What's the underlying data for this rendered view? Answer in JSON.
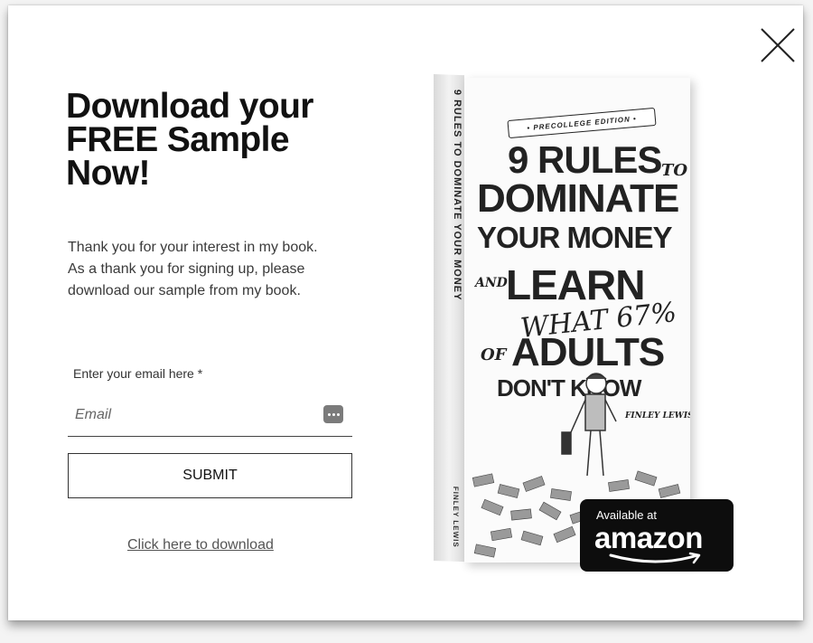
{
  "modal": {
    "close_icon": "close-icon",
    "headline": [
      "Download your",
      "FREE Sample",
      "Now!"
    ],
    "intro": [
      "Thank you for your interest in my book.",
      "As a thank you for signing up, please",
      "download our sample from my book."
    ],
    "email": {
      "label": "Enter your email here *",
      "placeholder": "Email",
      "value": "",
      "autofill_icon": "more-dots-icon"
    },
    "submit_label": "SUBMIT",
    "download_link": "Click here to download"
  },
  "book": {
    "spine_title": "9 RULES TO DOMINATE YOUR MONEY",
    "spine_author": "FINLEY LEWIS",
    "edition": "• PRECOLLEGE EDITION •",
    "cover_lines": {
      "rules": "9 RULES",
      "to": "TO",
      "dominate": "DOMINATE",
      "your_money": "YOUR MONEY",
      "and": "AND",
      "learn": "LEARN",
      "what": "WHAT 67%",
      "of": "OF",
      "adults": "ADULTS",
      "dont_know": "DON'T KNOW",
      "author": "FINLEY LEWIS"
    }
  },
  "badge": {
    "small": "Available at",
    "big": "amazon"
  }
}
